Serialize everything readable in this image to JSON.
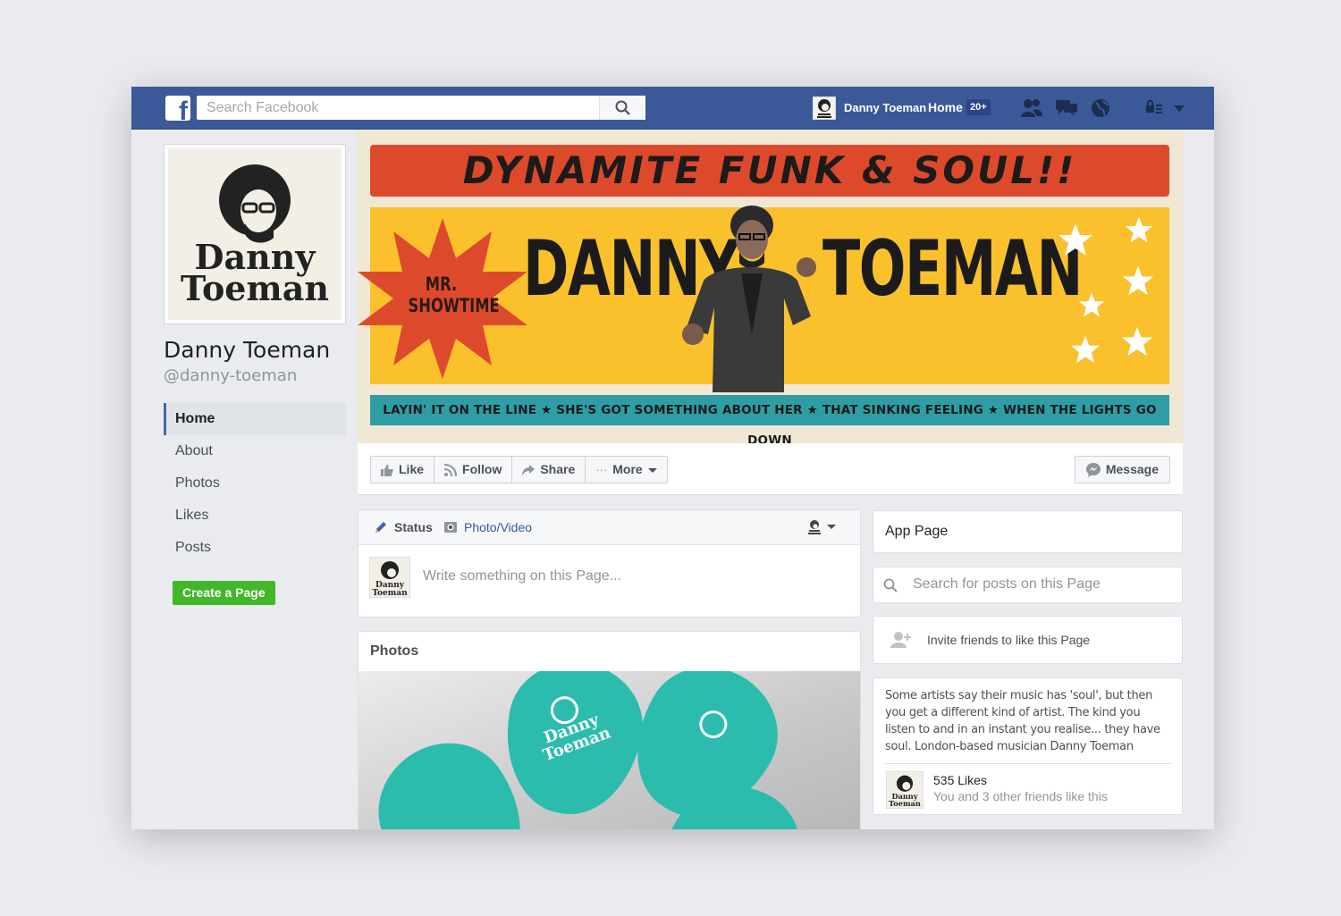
{
  "topbar": {
    "search_placeholder": "Search Facebook",
    "user_name": "Danny Toeman",
    "home_label": "Home",
    "notification_badge": "20+"
  },
  "sidebar": {
    "page_name": "Danny Toeman",
    "handle": "@danny-toeman",
    "nav": [
      {
        "label": "Home",
        "active": true
      },
      {
        "label": "About"
      },
      {
        "label": "Photos"
      },
      {
        "label": "Likes"
      },
      {
        "label": "Posts"
      }
    ],
    "create_page_label": "Create a Page"
  },
  "cover": {
    "headline": "DYNAMITE FUNK & SOUL!!",
    "name_first": "DANNY",
    "name_last": "TOEMAN",
    "starburst_line1": "MR.",
    "starburst_line2": "SHOWTIME",
    "tagline": "LAYIN' IT ON THE LINE ★ SHE'S GOT SOMETHING ABOUT HER ★ THAT SINKING FEELING ★ WHEN THE LIGHTS GO DOWN"
  },
  "actions": {
    "like": "Like",
    "follow": "Follow",
    "share": "Share",
    "more": "More",
    "message": "Message"
  },
  "composer": {
    "status_tab": "Status",
    "photo_tab": "Photo/Video",
    "placeholder": "Write something on this Page..."
  },
  "photos": {
    "title": "Photos",
    "pick_text_top": "Danny",
    "pick_text_bottom": "Toeman"
  },
  "right": {
    "app_page": "App Page",
    "search_placeholder": "Search for posts on this Page",
    "invite_text": "Invite friends to like this Page",
    "about": "Some artists say their music has 'soul', but then you get a different kind of artist. The kind you listen to and in an instant you realise... they have soul. London-based musician Danny Toeman",
    "likes_count": "535 Likes",
    "likes_friends": "You and 3 other friends like this"
  },
  "logo": {
    "line1": "Danny",
    "line2": "Toeman"
  },
  "colors": {
    "brand_blue": "#3b5998",
    "cover_red": "#dd4a2b",
    "cover_yellow": "#fbc12d",
    "cover_teal": "#2e9ea4",
    "button_green": "#42b72a"
  }
}
